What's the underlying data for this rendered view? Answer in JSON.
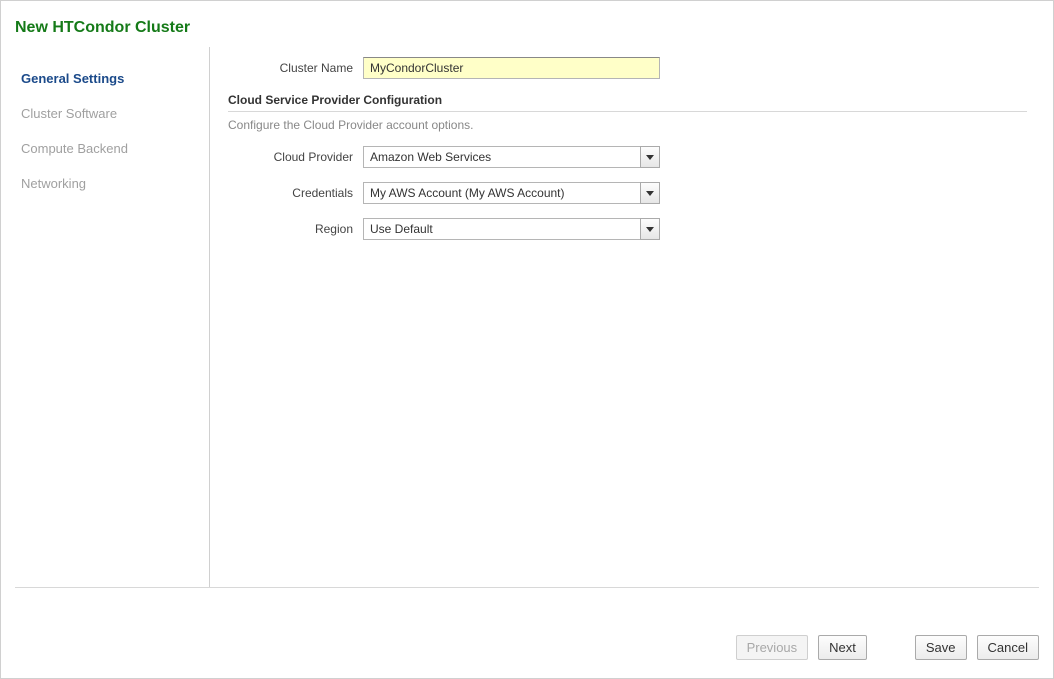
{
  "title": "New HTCondor Cluster",
  "nav": {
    "items": [
      {
        "label": "General Settings",
        "active": true
      },
      {
        "label": "Cluster Software",
        "active": false
      },
      {
        "label": "Compute Backend",
        "active": false
      },
      {
        "label": "Networking",
        "active": false
      }
    ]
  },
  "form": {
    "cluster_name_label": "Cluster Name",
    "cluster_name_value": "MyCondorCluster",
    "section_header": "Cloud Service Provider Configuration",
    "section_desc": "Configure the Cloud Provider account options.",
    "cloud_provider_label": "Cloud Provider",
    "cloud_provider_value": "Amazon Web Services",
    "credentials_label": "Credentials",
    "credentials_value": "My AWS Account (My AWS Account)",
    "region_label": "Region",
    "region_value": "Use Default"
  },
  "buttons": {
    "previous": "Previous",
    "next": "Next",
    "save": "Save",
    "cancel": "Cancel"
  }
}
